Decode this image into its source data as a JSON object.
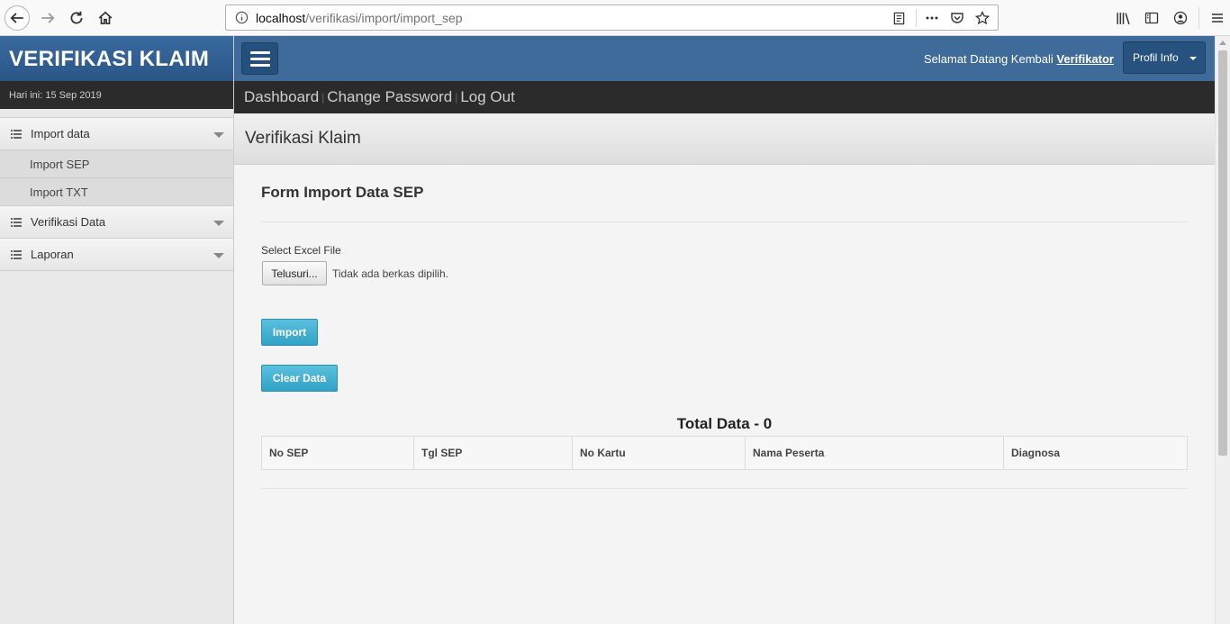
{
  "browser": {
    "url_host": "localhost",
    "url_path": "/verifikasi/import/import_sep"
  },
  "sidebar": {
    "brand": "VERIFIKASI KLAIM",
    "date": "Hari ini: 15 Sep 2019",
    "menu": [
      {
        "label": "Import data",
        "children": [
          "Import SEP",
          "Import TXT"
        ]
      },
      {
        "label": "Verifikasi Data"
      },
      {
        "label": "Laporan"
      }
    ]
  },
  "header": {
    "welcome_text": "Selamat Datang Kembali",
    "user": "Verifikator",
    "profile_button": "Profil Info"
  },
  "nav": {
    "items": [
      "Dashboard",
      "Change Password",
      "Log Out"
    ],
    "separator": "|"
  },
  "page": {
    "title": "Verifikasi Klaim"
  },
  "form": {
    "title": "Form Import Data SEP",
    "file_label": "Select Excel File",
    "browse_button": "Telusuri...",
    "file_status": "Tidak ada berkas dipilih.",
    "import_button": "Import",
    "clear_button": "Clear Data"
  },
  "table": {
    "total_label": "Total Data - 0",
    "columns": [
      "No SEP",
      "Tgl SEP",
      "No Kartu",
      "Nama Peserta",
      "Diagnosa"
    ]
  },
  "colors": {
    "brand_blue": "#3f6b9b",
    "dark_bar": "#2b2b2b",
    "button_info": "#5bc0de"
  }
}
